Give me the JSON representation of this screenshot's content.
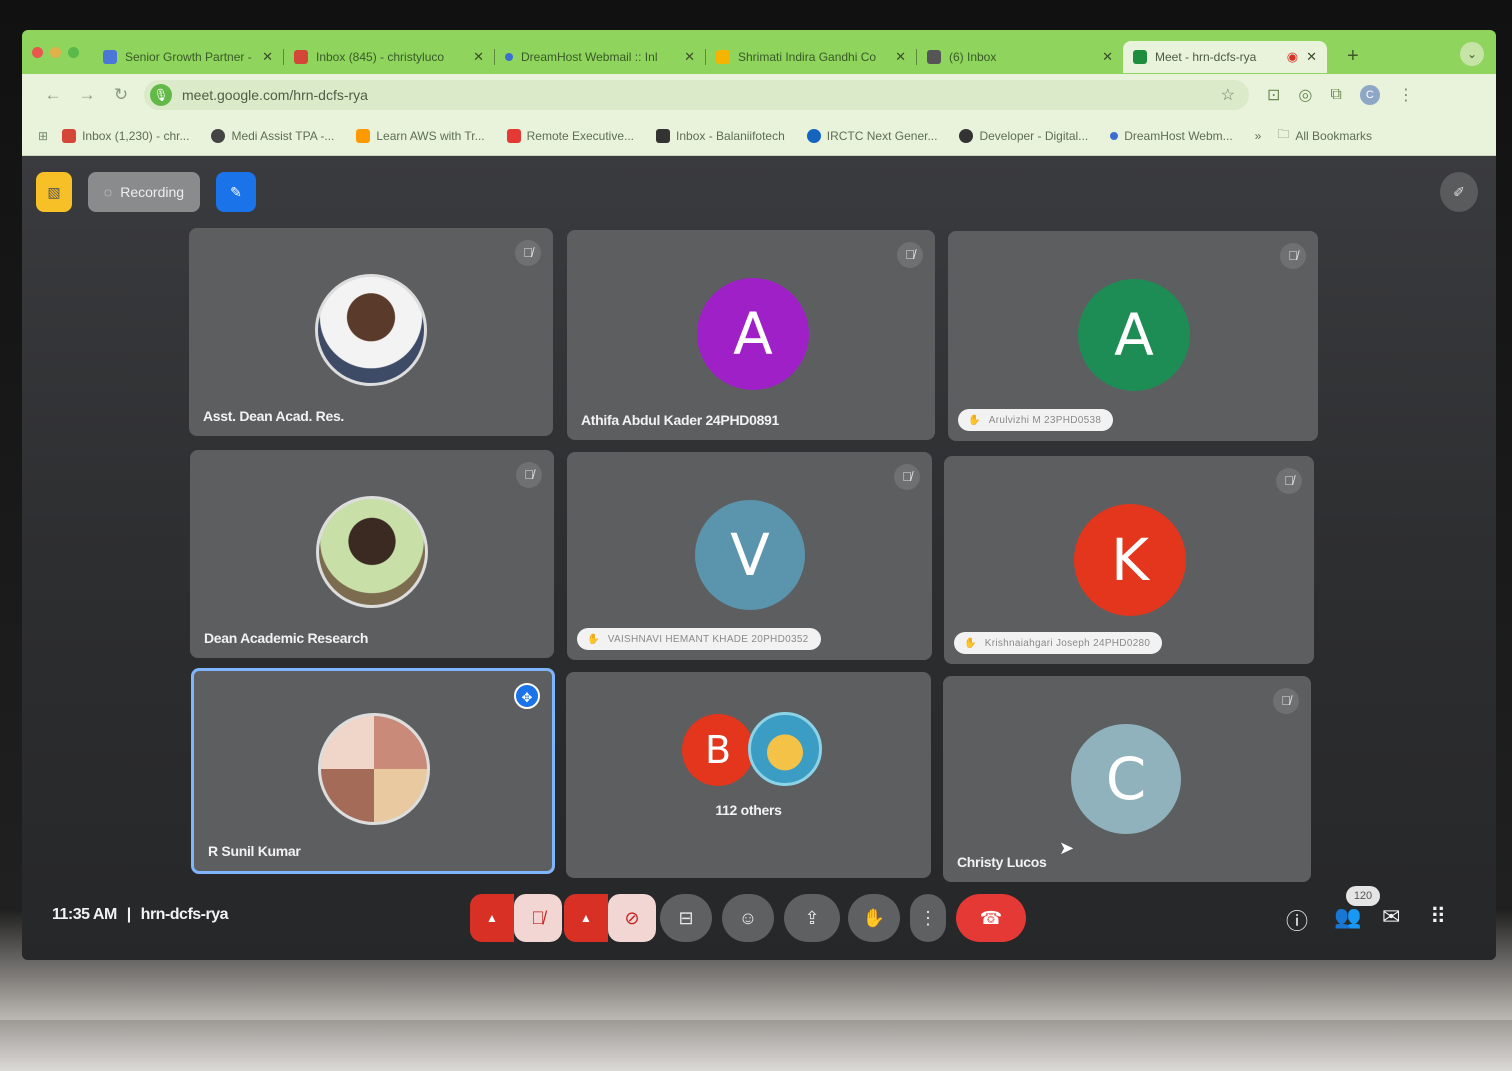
{
  "browser": {
    "tabs": [
      {
        "label": "Senior Growth Partner - ",
        "favicon_color": "#4a76d6"
      },
      {
        "label": "Inbox (845) - christyluco",
        "favicon_color": "#d44638"
      },
      {
        "label": "DreamHost Webmail :: Inl",
        "favicon_color": "#3b6fd1"
      },
      {
        "label": "Shrimati Indira Gandhi Co",
        "favicon_color": "#f4b400"
      },
      {
        "label": "(6) Inbox",
        "favicon_color": "#555555"
      },
      {
        "label": "Meet - hrn-dcfs-rya",
        "favicon_color": "#1e8e3e",
        "active": true
      }
    ],
    "url": "meet.google.com/hrn-dcfs-rya",
    "bookmarks": [
      {
        "label": "Inbox (1,230) - chr...",
        "icon_color": "#d44638"
      },
      {
        "label": "Medi Assist TPA -...",
        "icon_color": "#444444"
      },
      {
        "label": "Learn AWS with Tr...",
        "icon_color": "#ff9900"
      },
      {
        "label": "Remote Executive...",
        "icon_color": "#e53935"
      },
      {
        "label": "Inbox - Balaniifotech",
        "icon_color": "#333333"
      },
      {
        "label": "IRCTC Next Gener...",
        "icon_color": "#1565c0"
      },
      {
        "label": "Developer - Digital...",
        "icon_color": "#333333"
      },
      {
        "label": "DreamHost Webm...",
        "icon_color": "#3b6fd1"
      }
    ],
    "bookmarks_more": "»",
    "all_bookmarks": "All Bookmarks"
  },
  "meet": {
    "recording_label": "Recording",
    "time": "11:35 AM",
    "separator": "|",
    "meeting_code": "hrn-dcfs-rya",
    "participants_count": "120",
    "tiles": [
      {
        "name": "Asst. Dean Acad. Res.",
        "kind": "photo",
        "muted": true
      },
      {
        "name": "Athifa Abdul Kader 24PHD0891",
        "kind": "letter",
        "letter": "A",
        "color": "#a020c8",
        "muted": true
      },
      {
        "name": "Arulvizhi M 23PHD0538",
        "kind": "letter",
        "letter": "A",
        "color": "#1e8c55",
        "muted": true,
        "hand": true
      },
      {
        "name": "Dean Academic Research",
        "kind": "photo",
        "muted": true
      },
      {
        "name": "VAISHNAVI HEMANT KHADE 20PHD0352",
        "kind": "letter",
        "letter": "V",
        "color": "#5b94ad",
        "muted": true,
        "hand": true
      },
      {
        "name": "Krishnaiahgari Joseph 24PHD0280",
        "kind": "letter",
        "letter": "K",
        "color": "#e4361d",
        "muted": true,
        "hand": true
      },
      {
        "name": "R Sunil Kumar",
        "kind": "photo",
        "selected": true
      },
      {
        "name": "112 others",
        "kind": "others",
        "letter": "B",
        "color": "#e4361d"
      },
      {
        "name": "Christy Lucos",
        "kind": "letter",
        "letter": "C",
        "color": "#8fb2bd",
        "muted": true
      }
    ]
  }
}
